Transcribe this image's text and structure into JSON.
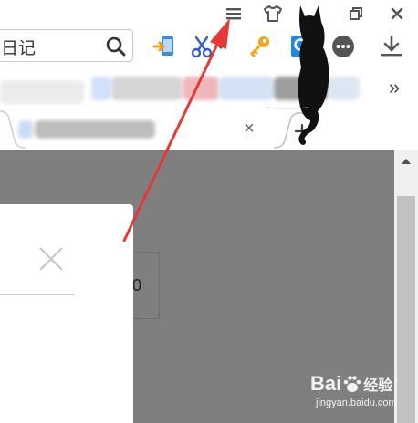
{
  "search": {
    "value": "日记"
  },
  "tab": {
    "close_glyph": "×"
  },
  "overflow": {
    "label": "»"
  },
  "dialog": {
    "close_glyph": "×"
  },
  "background": {
    "field_text": "0"
  },
  "watermark": {
    "brand": "Bai",
    "brand_suffix": "经验",
    "domain": "jingyan.baidu.com"
  },
  "colors": {
    "accent_red": "#e53935",
    "content_gray": "#7f7f7f",
    "scroll_thumb": "#c1c1c1",
    "icon_dark": "#555555"
  }
}
